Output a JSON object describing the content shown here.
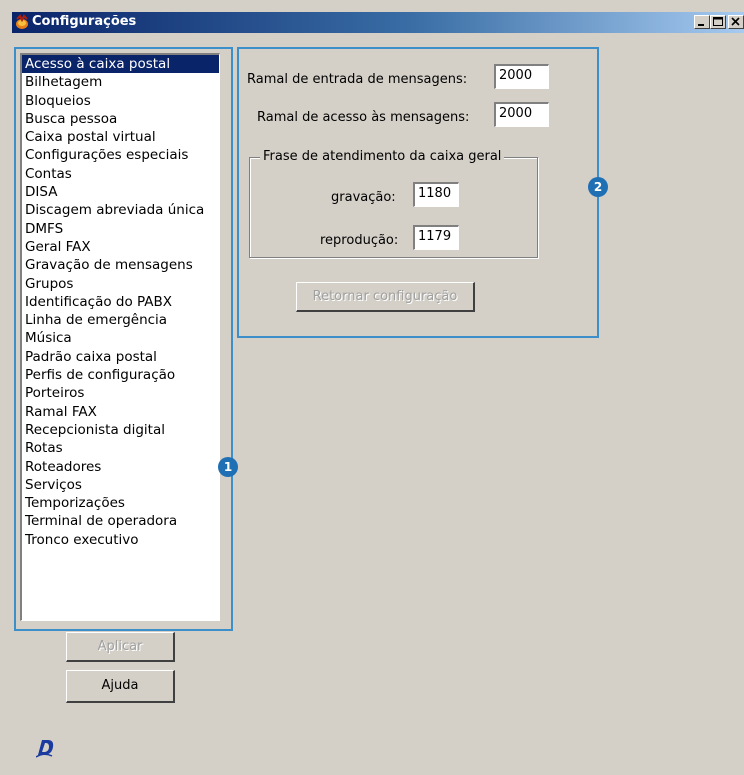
{
  "window": {
    "title": "Configurações",
    "buttons": {
      "minimize": "_",
      "maximize": "□",
      "close": "X"
    }
  },
  "list": {
    "selected_index": 0,
    "items": [
      "Acesso à caixa postal",
      "Bilhetagem",
      "Bloqueios",
      "Busca pessoa",
      "Caixa postal virtual",
      "Configurações especiais",
      "Contas",
      "DISA",
      "Discagem abreviada única",
      "DMFS",
      "Geral FAX",
      "Gravação de mensagens",
      "Grupos",
      "Identificação do PABX",
      "Linha de emergência",
      "Música",
      "Padrão caixa postal",
      "Perfis de configuração",
      "Porteiros",
      "Ramal FAX",
      "Recepcionista digital",
      "Rotas",
      "Roteadores",
      "Serviços",
      "Temporizações",
      "Terminal de operadora",
      "Tronco executivo"
    ]
  },
  "form": {
    "entrada_label": "Ramal de entrada de mensagens:",
    "entrada_value": "2000",
    "acesso_label": "Ramal de acesso às mensagens:",
    "acesso_value": "2000",
    "group": {
      "title": "Frase de atendimento da caixa geral",
      "gravacao_label": "gravação:",
      "gravacao_value": "1180",
      "reproducao_label": "reprodução:",
      "reproducao_value": "1179"
    },
    "retornar_label": "Retornar configuração"
  },
  "actions": {
    "aplicar_label": "Aplicar",
    "ajuda_label": "Ajuda"
  },
  "callouts": {
    "one": "1",
    "two": "2"
  },
  "colors": {
    "titlebar_start": "#0a246a",
    "callout_frame": "#3c8fc8",
    "badge": "#1f6fb5",
    "selection": "#0a246a"
  },
  "logo_text": "D"
}
